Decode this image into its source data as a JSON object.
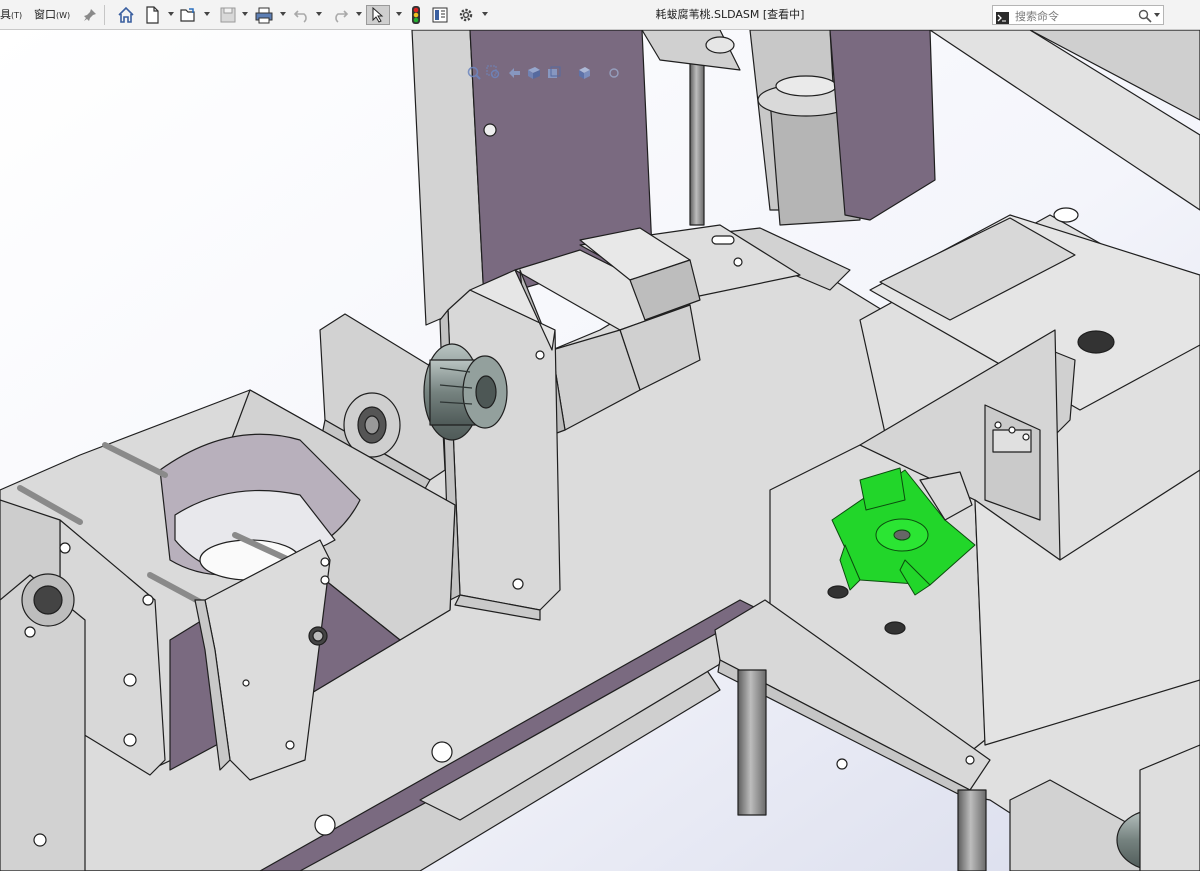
{
  "menus": [
    {
      "label": "具",
      "key": "(T)"
    },
    {
      "label": "窗口",
      "key": "(W)"
    }
  ],
  "window_title": "耗蛂腐苇桃.SLDASM [查看中]",
  "search": {
    "placeholder": "搜索命令"
  },
  "icons": [
    "pin-icon",
    "home-icon",
    "new-file-icon",
    "open-file-icon",
    "save-icon",
    "print-icon",
    "undo-icon",
    "redo-icon",
    "select-arrow-icon",
    "rebuild-light-icon",
    "file-props-icon",
    "options-gear-icon",
    "command-prompt-icon",
    "search-icon"
  ],
  "colors": {
    "toolbar_bg": "#f3f3f3",
    "part_grey": "#d6d6d6",
    "part_purple": "#7a6a80",
    "selected_green": "#22d62a",
    "coupling_grey": "#7e8a8a"
  }
}
